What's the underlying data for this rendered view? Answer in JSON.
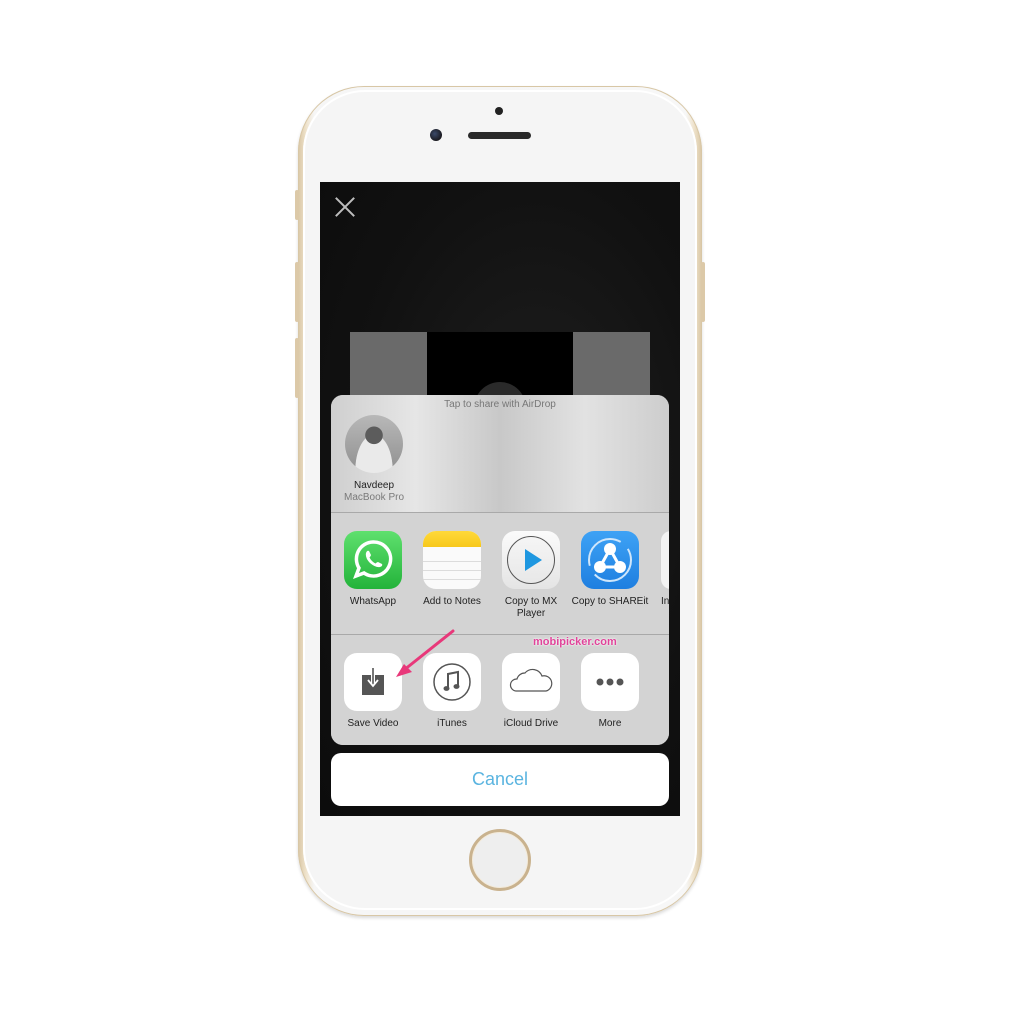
{
  "device": "iPhone (gold)",
  "screen": {
    "close_icon": "close-x-icon"
  },
  "share_sheet": {
    "airdrop": {
      "hint": "Tap to share with AirDrop",
      "contacts": [
        {
          "name": "Navdeep",
          "device": "MacBook Pro"
        }
      ]
    },
    "apps": [
      {
        "label": "WhatsApp",
        "icon": "whatsapp-icon"
      },
      {
        "label": "Add to Notes",
        "icon": "notes-icon"
      },
      {
        "label": "Copy to MX Player",
        "icon": "mx-player-icon"
      },
      {
        "label": "Copy to SHAREit",
        "icon": "shareit-icon"
      },
      {
        "label": "In",
        "icon": "partial-app-icon"
      }
    ],
    "actions": [
      {
        "label": "Save Video",
        "icon": "save-download-icon"
      },
      {
        "label": "iTunes",
        "icon": "itunes-music-icon"
      },
      {
        "label": "iCloud Drive",
        "icon": "icloud-icon"
      },
      {
        "label": "More",
        "icon": "more-dots-icon"
      }
    ],
    "cancel_label": "Cancel"
  },
  "annotation": {
    "watermark": "mobipicker.com",
    "arrow_color": "#e8387a"
  },
  "colors": {
    "cancel_text": "#5ab4e0",
    "whatsapp": "#2bbf45",
    "shareit": "#2b8fec",
    "mx_play": "#1e97e0",
    "notes_header": "#f7c81c"
  }
}
